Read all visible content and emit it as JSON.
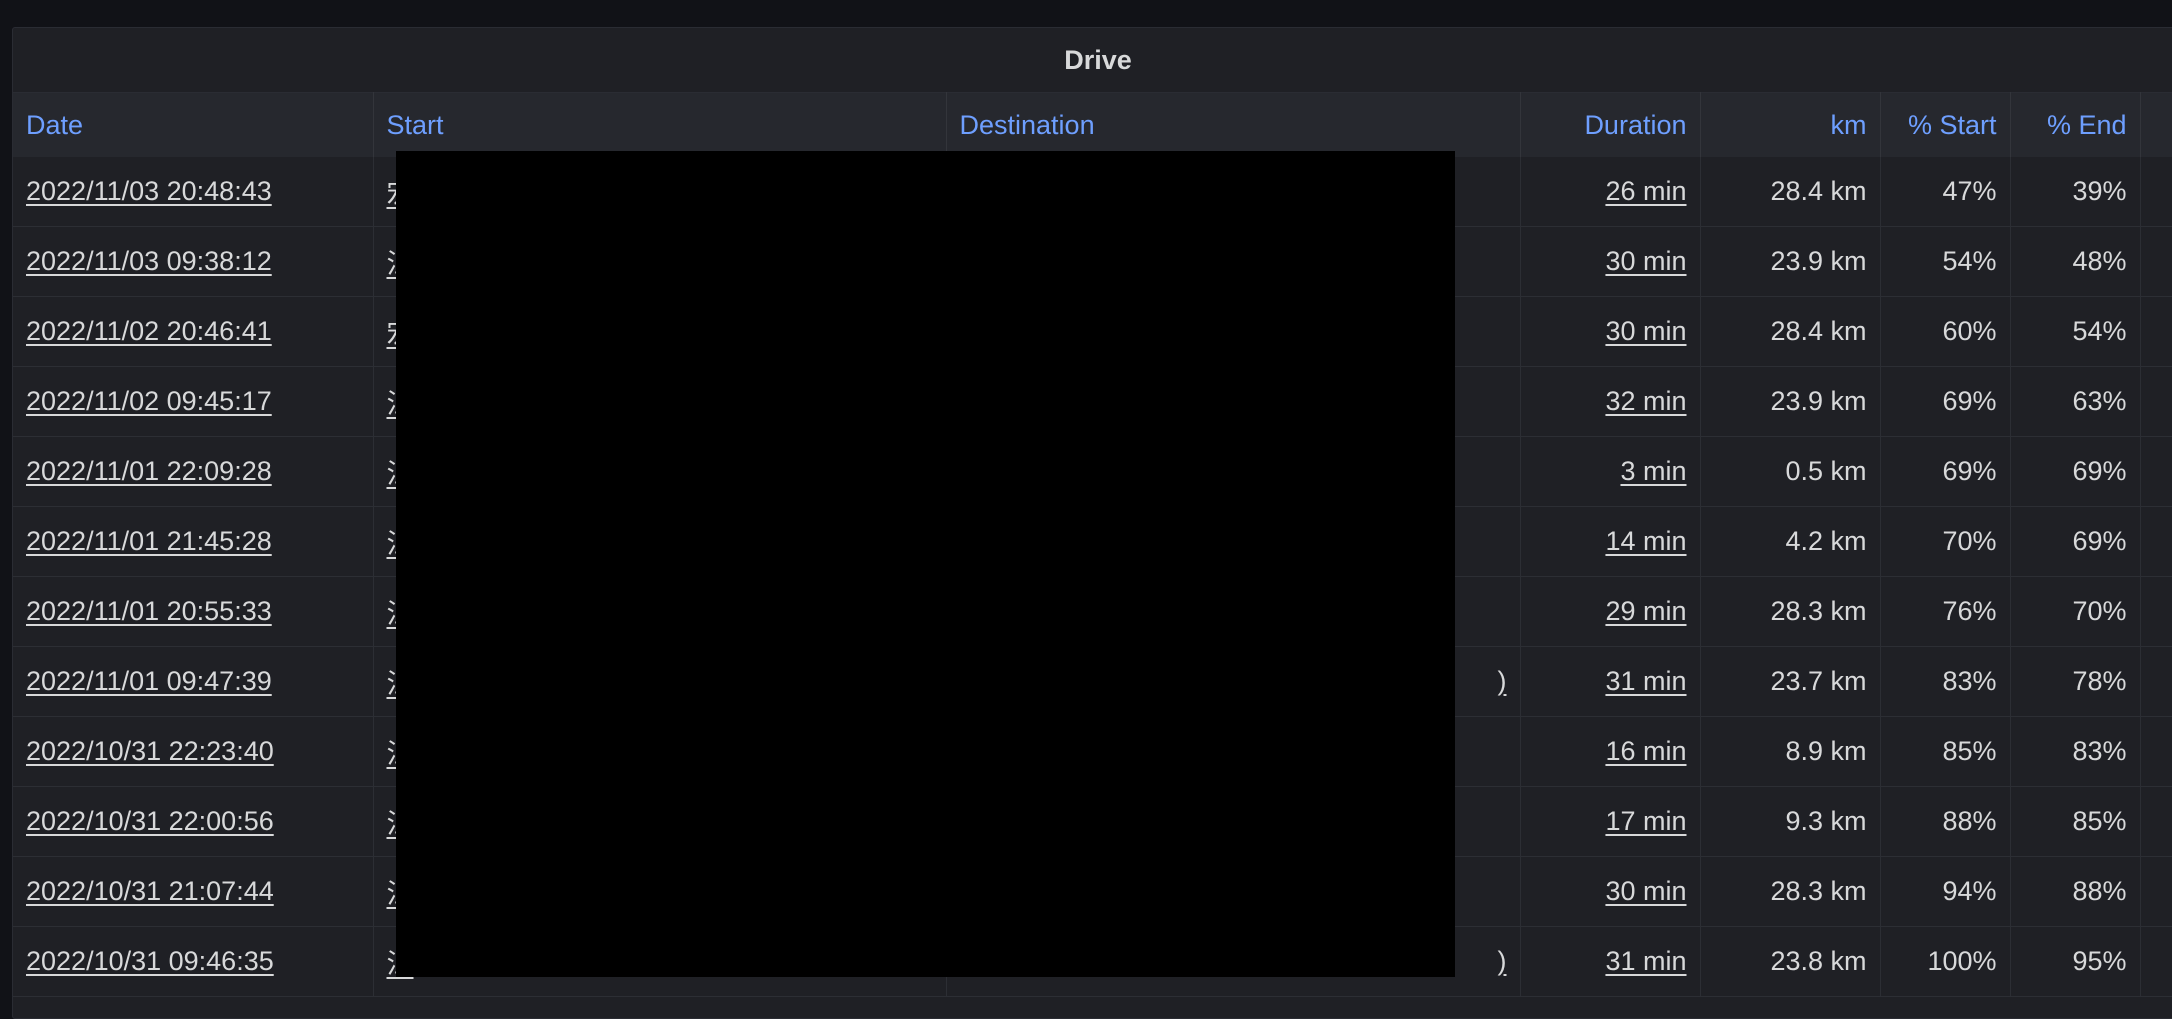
{
  "panel": {
    "title": "Drive"
  },
  "columns": {
    "date": "Date",
    "start": "Start",
    "destination": "Destination",
    "duration": "Duration",
    "km": "km",
    "pct_start": "% Start",
    "pct_end": "% End"
  },
  "rows": [
    {
      "date": "2022/11/03 20:48:43",
      "start": "宏",
      "destination": "",
      "duration": "26 min",
      "km": "28.4 km",
      "pct_start": "47%",
      "pct_end": "39%"
    },
    {
      "date": "2022/11/03 09:38:12",
      "start": "江",
      "destination": "",
      "duration": "30 min",
      "km": "23.9 km",
      "pct_start": "54%",
      "pct_end": "48%"
    },
    {
      "date": "2022/11/02 20:46:41",
      "start": "宏",
      "destination": "",
      "duration": "30 min",
      "km": "28.4 km",
      "pct_start": "60%",
      "pct_end": "54%"
    },
    {
      "date": "2022/11/02 09:45:17",
      "start": "江",
      "destination": "",
      "duration": "32 min",
      "km": "23.9 km",
      "pct_start": "69%",
      "pct_end": "63%"
    },
    {
      "date": "2022/11/01 22:09:28",
      "start": "江",
      "destination": "",
      "duration": "3 min",
      "km": "0.5 km",
      "pct_start": "69%",
      "pct_end": "69%"
    },
    {
      "date": "2022/11/01 21:45:28",
      "start": "江",
      "destination": "",
      "duration": "14 min",
      "km": "4.2 km",
      "pct_start": "70%",
      "pct_end": "69%"
    },
    {
      "date": "2022/11/01 20:55:33",
      "start": "江",
      "destination": "",
      "duration": "29 min",
      "km": "28.3 km",
      "pct_start": "76%",
      "pct_end": "70%"
    },
    {
      "date": "2022/11/01 09:47:39",
      "start": "江",
      "destination": ")",
      "duration": "31 min",
      "km": "23.7 km",
      "pct_start": "83%",
      "pct_end": "78%"
    },
    {
      "date": "2022/10/31 22:23:40",
      "start": "江",
      "destination": "",
      "duration": "16 min",
      "km": "8.9 km",
      "pct_start": "85%",
      "pct_end": "83%"
    },
    {
      "date": "2022/10/31 22:00:56",
      "start": "江",
      "destination": "",
      "duration": "17 min",
      "km": "9.3 km",
      "pct_start": "88%",
      "pct_end": "85%"
    },
    {
      "date": "2022/10/31 21:07:44",
      "start": "江",
      "destination": "",
      "duration": "30 min",
      "km": "28.3 km",
      "pct_start": "94%",
      "pct_end": "88%"
    },
    {
      "date": "2022/10/31 09:46:35",
      "start": "江",
      "destination": ")",
      "duration": "31 min",
      "km": "23.8 km",
      "pct_start": "100%",
      "pct_end": "95%"
    }
  ],
  "colors": {
    "background": "#111217",
    "panel": "#1f2025",
    "header_row": "#26282e",
    "header_text": "#6e9fff",
    "text": "#d8d9da",
    "redaction": "#000000"
  }
}
